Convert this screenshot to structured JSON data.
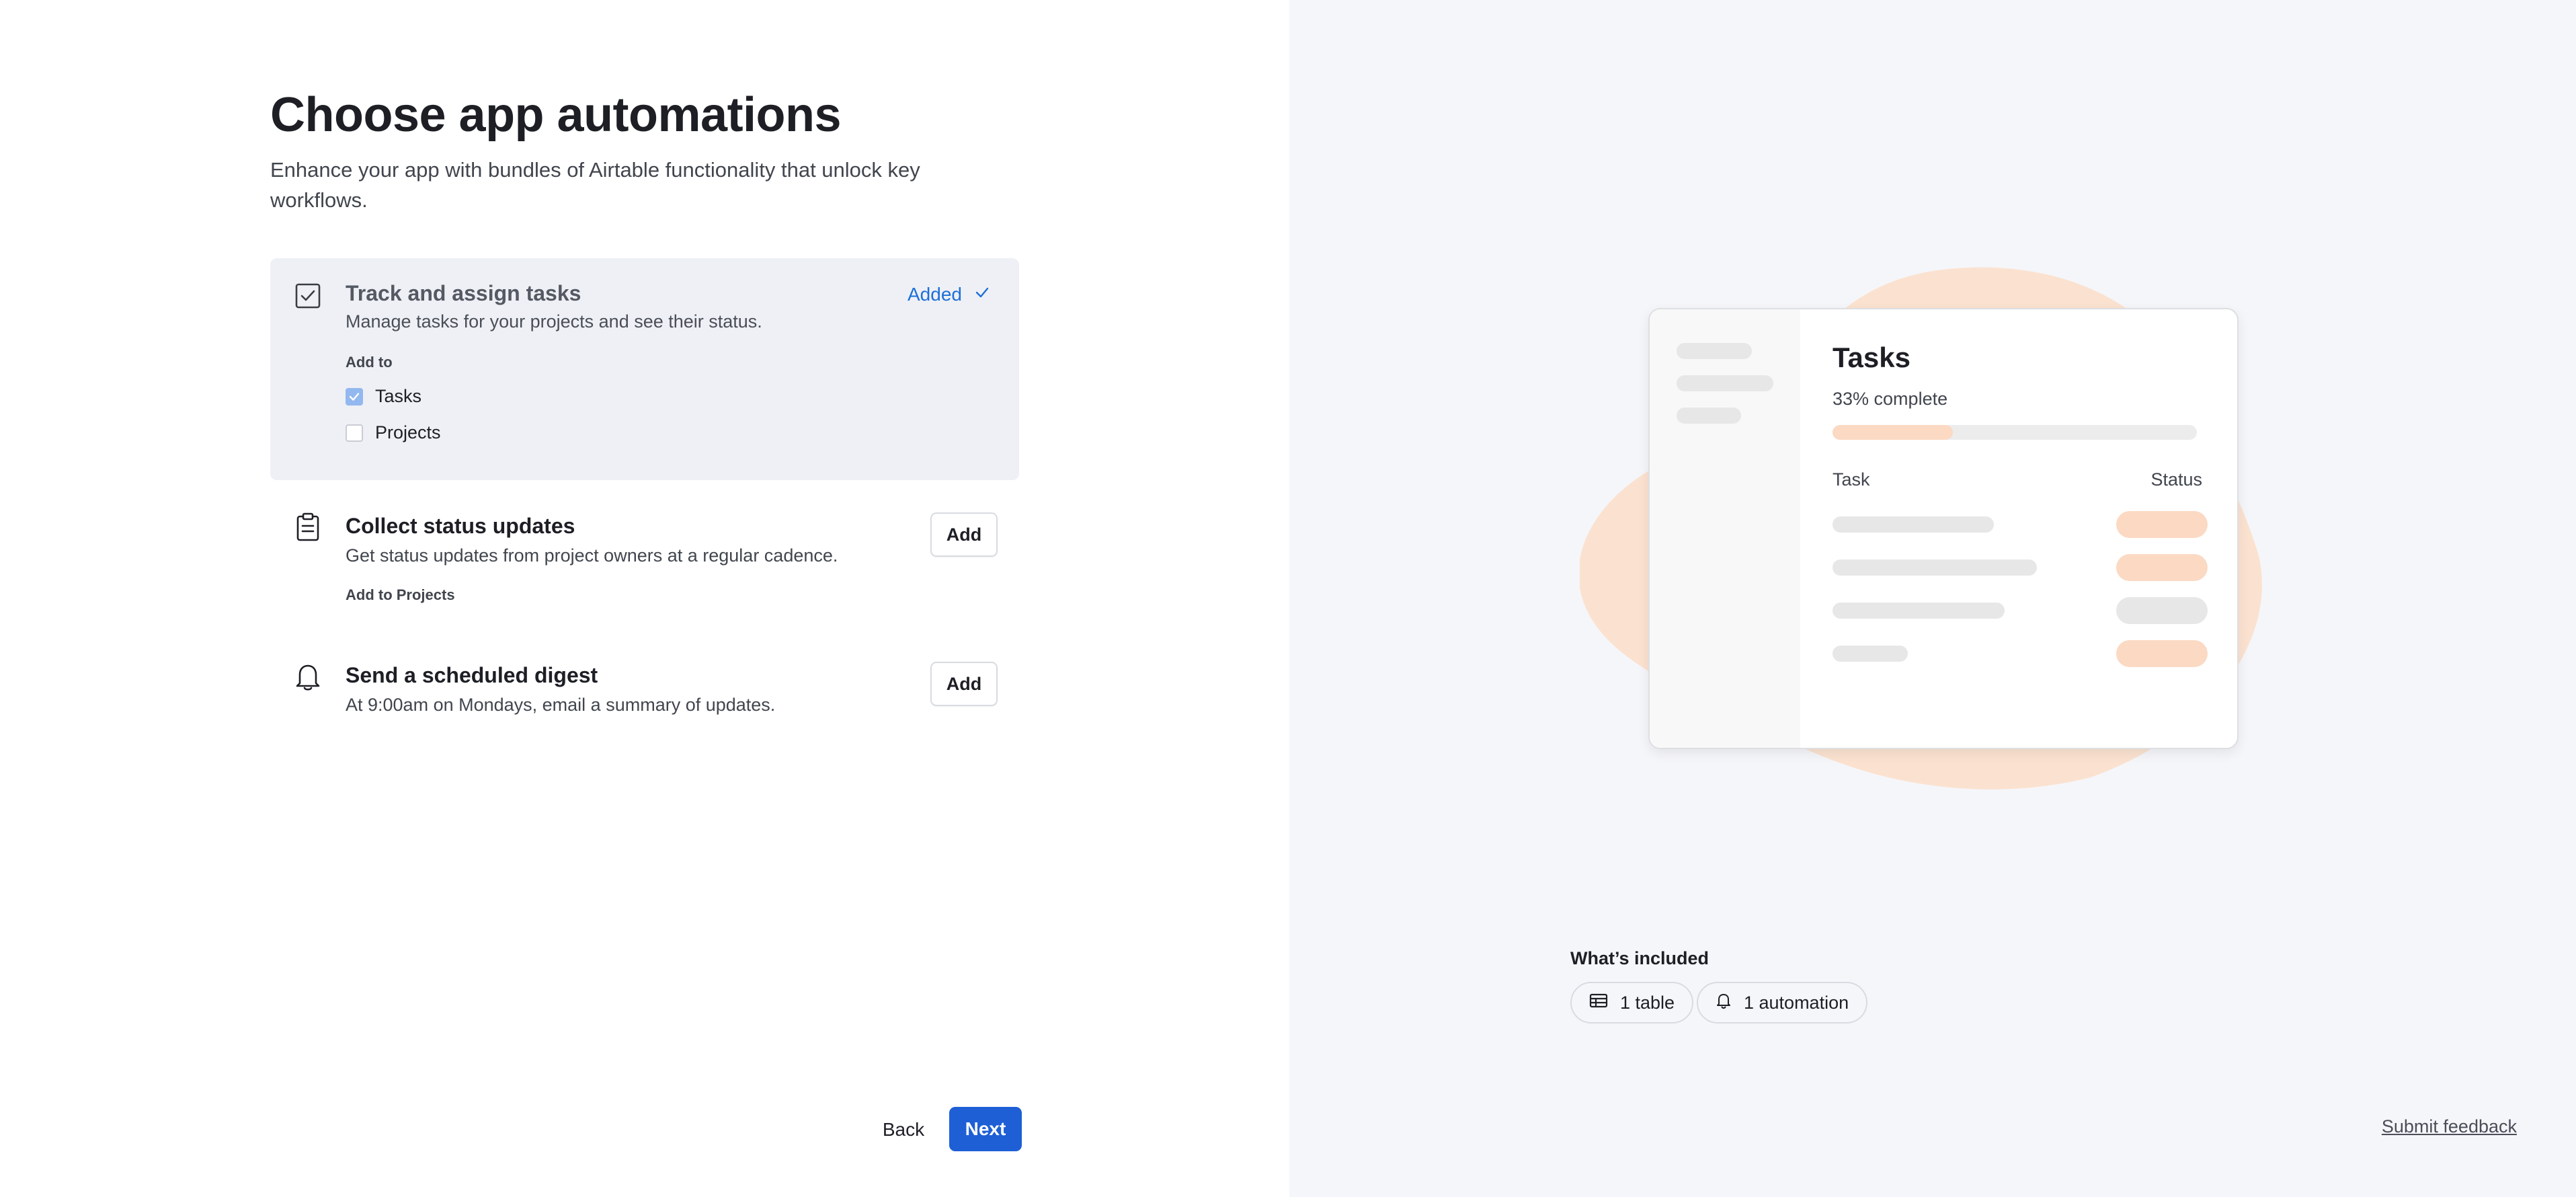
{
  "header": {
    "title": "Choose app automations",
    "subtitle": "Enhance your app with bundles of Airtable functionality that unlock key workflows."
  },
  "automations": [
    {
      "title": "Track and assign tasks",
      "description": "Manage tasks for your projects and see their status.",
      "status_label": "Added",
      "add_to_label": "Add to",
      "options": [
        {
          "label": "Tasks",
          "checked": true
        },
        {
          "label": "Projects",
          "checked": false
        }
      ]
    },
    {
      "title": "Collect status updates",
      "description": "Get status updates from project owners at a regular cadence.",
      "button_label": "Add",
      "note": "Add to Projects"
    },
    {
      "title": "Send a scheduled digest",
      "description": "At 9:00am on Mondays, email a summary of updates.",
      "button_label": "Add"
    }
  ],
  "footer": {
    "back_label": "Back",
    "next_label": "Next"
  },
  "preview": {
    "title": "Tasks",
    "progress_label": "33% complete",
    "progress_fraction": 0.33,
    "column_task": "Task",
    "column_status": "Status"
  },
  "included": {
    "heading": "What’s included",
    "chips": [
      {
        "label": "1 table",
        "icon": "table-icon"
      },
      {
        "label": "1 automation",
        "icon": "bell-icon"
      }
    ]
  },
  "feedback_label": "Submit feedback",
  "colors": {
    "accent": "#1e5fd6",
    "added_text": "#1d6fd8",
    "selected_card_bg": "#eef0f5",
    "preview_accent": "#fbd9c3",
    "blob": "#fbe2d0",
    "right_pane_bg": "#f5f6fa"
  }
}
